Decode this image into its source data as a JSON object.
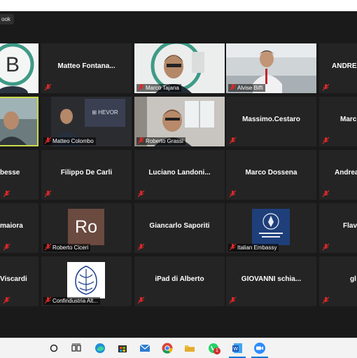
{
  "meeting": {
    "tag_label": "ook",
    "speaker_color": "#c9d94a"
  },
  "participants": {
    "r1c1": "",
    "r1c2": "Matteo  Fontana...",
    "r1c3": "Marco Tajana",
    "r1c4": "Alvise Biffi",
    "r1c5": "ANDREA",
    "r2c1": "",
    "r2c2": "Matteo Colombo",
    "r2c3": "Roberto Grassi",
    "r2c4": "Massimo.Cestaro",
    "r2c5": "Marc",
    "r3c1": "besse",
    "r3c2": "Filippo De Carli",
    "r3c3": "Luciano  Landoni...",
    "r3c4": "Marco Dossena",
    "r3c5": "Andrea",
    "r4c1": "maiora",
    "r4c2": "Roberto Ciceri",
    "r4c3": "Giancarlo Saporiti",
    "r4c4": "Italian Embassy",
    "r4c5": "Flavi",
    "r5c1": "Viscardi",
    "r5c2": "Confindustria Alt...",
    "r5c3": "iPad di Alberto",
    "r5c4": "GIOVANNI  schia...",
    "r5c5": "gl"
  },
  "avatars": {
    "ro_initials": "Ro",
    "ro_color": "#6b4a3f",
    "hevor_text": "HEVOR"
  },
  "taskbar": {
    "icons": [
      "search-icon",
      "task-view-icon",
      "edge-icon",
      "store-icon",
      "mail-icon",
      "chrome-icon",
      "file-explorer-icon",
      "whatsapp-icon",
      "word-icon",
      "zoom-icon"
    ],
    "whatsapp_badge": "1"
  }
}
